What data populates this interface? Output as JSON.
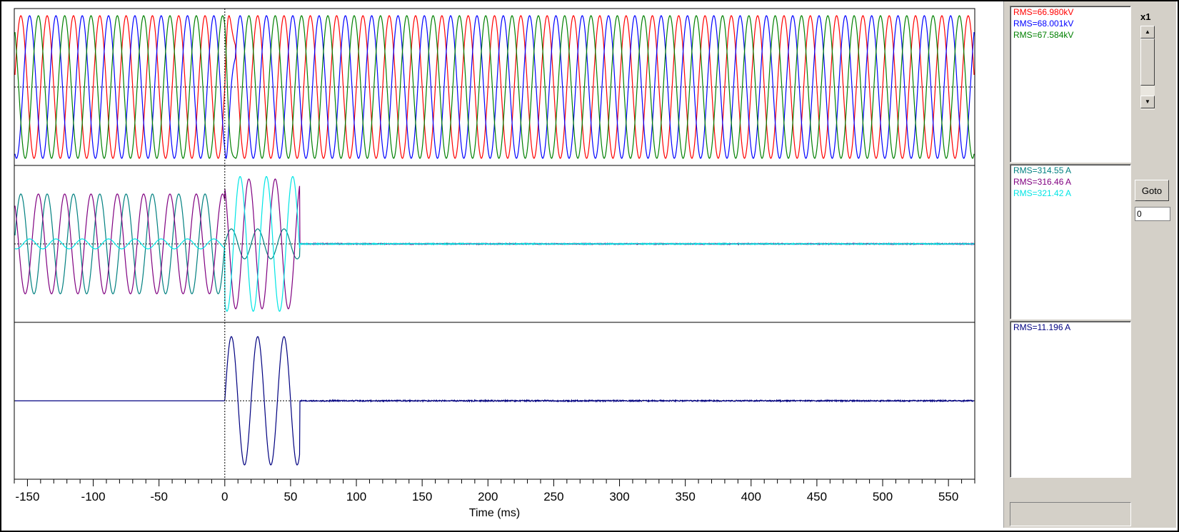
{
  "colors": {
    "red": "#ff0000",
    "blue": "#0000ff",
    "green": "#008000",
    "teal": "#008080",
    "purple": "#800080",
    "cyan": "#00e5e5",
    "navy": "#000080"
  },
  "rms_panels": [
    {
      "lines": [
        {
          "text": "RMS=66.980kV",
          "color": "#ff0000"
        },
        {
          "text": "RMS=68.001kV",
          "color": "#0000ff"
        },
        {
          "text": "RMS=67.584kV",
          "color": "#008000"
        }
      ]
    },
    {
      "lines": [
        {
          "text": "RMS=314.55 A",
          "color": "#008080"
        },
        {
          "text": "RMS=316.46 A",
          "color": "#800080"
        },
        {
          "text": "RMS=321.42 A",
          "color": "#00e5e5"
        }
      ]
    },
    {
      "lines": [
        {
          "text": "RMS=11.196 A",
          "color": "#000080"
        }
      ]
    }
  ],
  "controls": {
    "zoom_label": "x1",
    "scroll_up_icon": "scroll-up-arrow-icon",
    "scroll_down_icon": "scroll-down-arrow-icon",
    "goto_label": "Goto",
    "goto_value": "0"
  },
  "chart_data": {
    "type": "line",
    "xlabel": "Time (ms)",
    "xlim": [
      -160,
      570
    ],
    "x_ticks": [
      -150,
      -100,
      -50,
      0,
      50,
      100,
      150,
      200,
      250,
      300,
      350,
      400,
      450,
      500,
      550
    ],
    "frequency_hz": 50,
    "trigger_ms": 0,
    "fault_clear_ms": 57,
    "panels": [
      {
        "name": "voltages",
        "series": [
          {
            "color": "#ff0000",
            "amplitude": 1.0,
            "phase_deg": 0
          },
          {
            "color": "#0000ff",
            "amplitude": 1.0,
            "phase_deg": -120
          },
          {
            "color": "#008000",
            "amplitude": 1.0,
            "phase_deg": 120
          }
        ]
      },
      {
        "name": "phase-currents",
        "series": [
          {
            "color": "#008080",
            "pre_amplitude": 1.0,
            "fault_amplitude": 0.3,
            "post_amplitude": 0
          },
          {
            "color": "#800080",
            "pre_amplitude": 1.0,
            "fault_amplitude": 1.3,
            "post_amplitude": 0
          },
          {
            "color": "#00e5e5",
            "pre_amplitude": 0.1,
            "fault_amplitude": 1.35,
            "post_amplitude": 0
          }
        ]
      },
      {
        "name": "neutral-current",
        "series": [
          {
            "color": "#000080",
            "pre_amplitude": 0,
            "fault_amplitude": 1.0,
            "post_amplitude": 0
          }
        ]
      }
    ]
  }
}
